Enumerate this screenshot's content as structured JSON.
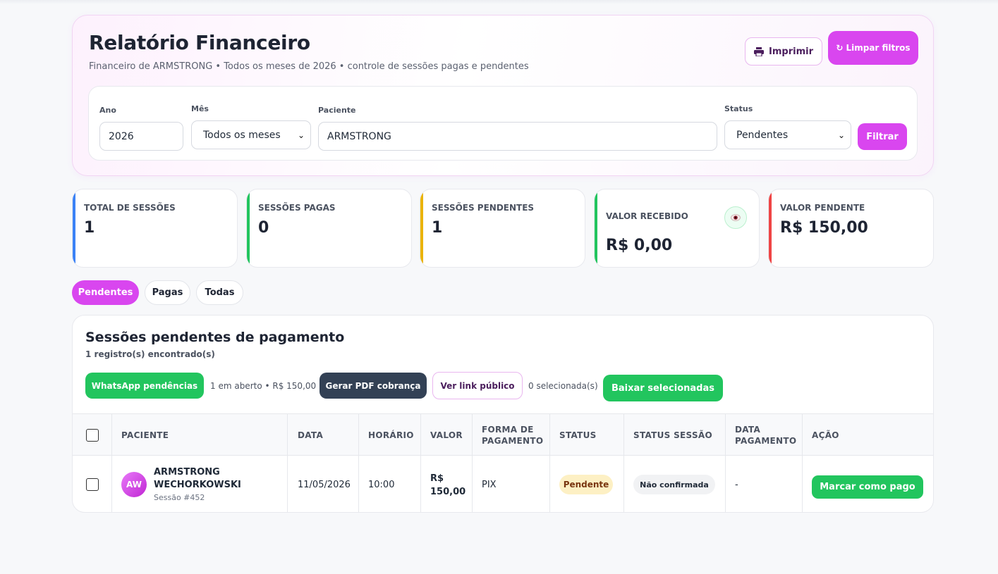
{
  "header": {
    "title": "Relatório Financeiro",
    "subtitle": "Financeiro de ARMSTRONG • Todos os meses de 2026 • controle de sessões pagas e pendentes",
    "print_label": "Imprimir",
    "clear_label": "Limpar filtros",
    "clear_icon": "↻"
  },
  "filters": {
    "year_label": "Ano",
    "year_value": "2026",
    "month_label": "Mês",
    "month_value": "Todos os meses",
    "patient_label": "Paciente",
    "patient_value": "ARMSTRONG",
    "status_label": "Status",
    "status_value": "Pendentes",
    "filter_button": "Filtrar"
  },
  "stats": [
    {
      "label": "TOTAL DE SESSÕES",
      "value": "1",
      "color": "#3b82f6"
    },
    {
      "label": "SESSÕES PAGAS",
      "value": "0",
      "color": "#22c55e"
    },
    {
      "label": "SESSÕES PENDENTES",
      "value": "1",
      "color": "#eab308"
    },
    {
      "label": "VALOR RECEBIDO",
      "value": "R$ 0,00",
      "color": "#22c55e"
    },
    {
      "label": "VALOR PENDENTE",
      "value": "R$ 150,00",
      "color": "#ef4444"
    }
  ],
  "tabs": [
    {
      "label": "Pendentes"
    },
    {
      "label": "Pagas"
    },
    {
      "label": "Todas"
    }
  ],
  "section": {
    "title": "Sessões pendentes de pagamento",
    "count": "1 registro(s) encontrado(s)",
    "whatsapp_button": "WhatsApp pendências",
    "open_summary": "1 em aberto • R$ 150,00",
    "pdf_button": "Gerar PDF cobrança",
    "link_button": "Ver link público",
    "selected_count": "0 selecionada(s)",
    "download_button": "Baixar selecionadas"
  },
  "table": {
    "headers": {
      "patient": "PACIENTE",
      "date": "DATA",
      "time": "HORÁRIO",
      "value": "VALOR",
      "payment_method_1": "FORMA DE",
      "payment_method_2": "PAGAMENTO",
      "status": "STATUS",
      "session_status": "STATUS SESSÃO",
      "payment_date_1": "DATA",
      "payment_date_2": "PAGAMENTO",
      "action": "AÇÃO"
    },
    "rows": [
      {
        "initials": "AW",
        "name_1": "ARMSTRONG",
        "name_2": "WECHORKOWSKI",
        "session": "Sessão #452",
        "date": "11/05/2026",
        "time": "10:00",
        "value_1": "R$",
        "value_2": "150,00",
        "payment_method": "PIX",
        "status": "Pendente",
        "session_status": "Não confirmada",
        "payment_date": "-",
        "action": "Marcar como pago"
      }
    ]
  },
  "colors": {
    "accent": "#d946ef",
    "success": "#22c55e",
    "dark": "#334155",
    "pending_bg": "#fdf0c4",
    "pending_text": "#78350f"
  }
}
